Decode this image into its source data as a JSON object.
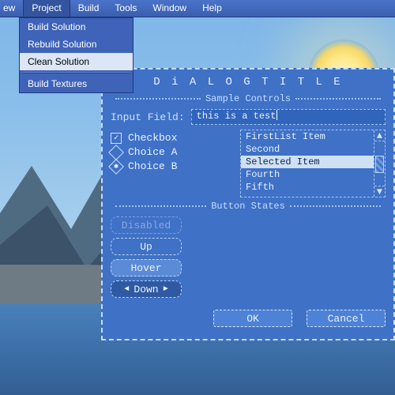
{
  "menubar": {
    "items": [
      {
        "label": "ew",
        "cut": true
      },
      {
        "label": "Project",
        "open": true
      },
      {
        "label": "Build"
      },
      {
        "label": "Tools"
      },
      {
        "label": "Window"
      },
      {
        "label": "Help"
      }
    ]
  },
  "dropdown": {
    "items": [
      {
        "label": "Build Solution"
      },
      {
        "label": "Rebuild Solution"
      },
      {
        "label": "Clean Solution",
        "highlighted": true
      },
      {
        "separator": true
      },
      {
        "label": "Build Textures"
      }
    ]
  },
  "dialog": {
    "title": "D i A L O G   T I T L E",
    "section1": "Sample Controls",
    "input_label": "Input Field:",
    "input_value": "this is a test",
    "checkbox_label": "Checkbox",
    "choice_a": "Choice A",
    "choice_b": "Choice B",
    "list": [
      "FirstList Item",
      "Second",
      "Selected Item",
      "Fourth",
      "Fifth"
    ],
    "list_selected_index": 2,
    "section2": "Button States",
    "btn_disabled": "Disabled",
    "btn_up": "Up",
    "btn_hover": "Hover",
    "btn_down": "Down",
    "ok": "OK",
    "cancel": "Cancel"
  }
}
